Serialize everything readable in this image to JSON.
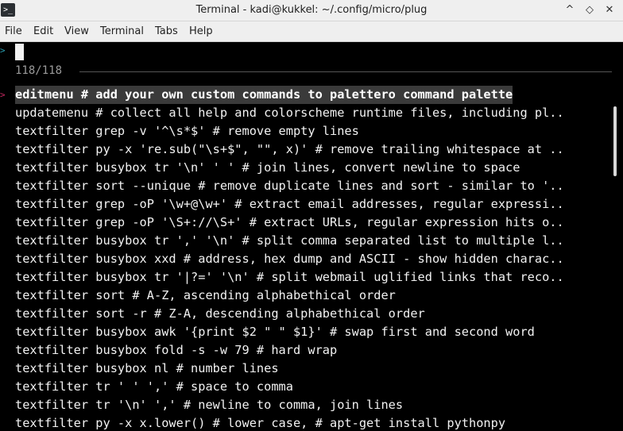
{
  "window": {
    "title": "Terminal - kadi@kukkel: ~/.config/micro/plug",
    "app_icon": ">_",
    "buttons": {
      "minimize": "^",
      "restore": "◇",
      "close": "✕"
    }
  },
  "menu": {
    "file": "File",
    "edit": "Edit",
    "view": "View",
    "terminal": "Terminal",
    "tabs": "Tabs",
    "help": "Help"
  },
  "prompt": {
    "symbol": ">",
    "marker": ">"
  },
  "picker": {
    "count": "118/118"
  },
  "results": [
    "editmenu # add your own custom commands to palettero command palette",
    "updatemenu # collect all help and colorscheme runtime files, including pl..",
    "textfilter grep -v '^\\s*$' # remove empty lines",
    "textfilter py -x 're.sub(\"\\s+$\", \"\", x)' # remove trailing whitespace at ..",
    "textfilter busybox tr '\\n' ' ' # join lines, convert newline to space",
    "textfilter sort --unique # remove duplicate lines and sort - similar to '..",
    "textfilter grep -oP '\\w+@\\w+' # extract email addresses, regular expressi..",
    "textfilter grep -oP '\\S+://\\S+' # extract URLs, regular expression hits o..",
    "textfilter busybox tr ',' '\\n' # split comma separated list to multiple l..",
    "textfilter busybox xxd # address, hex dump and ASCII - show hidden charac..",
    "textfilter busybox tr '|?=' '\\n' # split webmail uglified links that reco..",
    "textfilter sort # A-Z, ascending alphabethical order",
    "textfilter sort -r # Z-A, descending alphabethical order",
    "textfilter busybox awk '{print $2 \" \" $1}' # swap first and second word",
    "textfilter busybox fold -s -w 79 # hard wrap",
    "textfilter busybox nl # number lines",
    "textfilter tr ' ' ',' # space to comma",
    "textfilter tr '\\n' ',' # newline to comma, join lines",
    "textfilter py -x x.lower() # lower case, # apt-get install pythonpy"
  ],
  "colors": {
    "prompt": "#2aa1b3",
    "selection_marker": "#cc2a64",
    "terminal_bg": "#000000",
    "text": "#f2f2f2"
  }
}
